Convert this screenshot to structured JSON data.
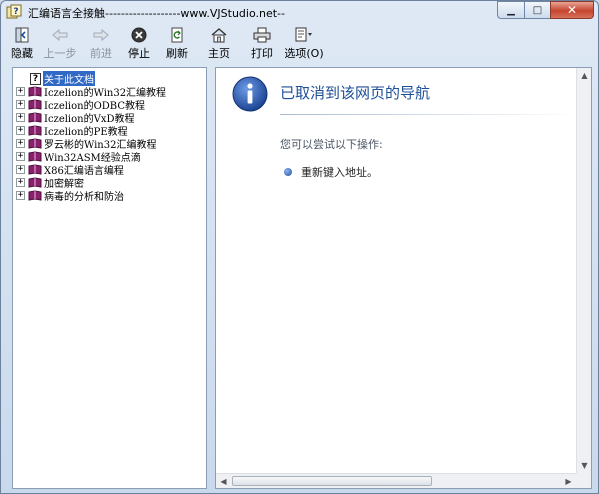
{
  "window": {
    "title": "汇编语言全接触-------------------www.VJStudio.net--"
  },
  "toolbar": {
    "buttons": [
      {
        "label": "隐藏",
        "icon": "hide-icon",
        "enabled": true
      },
      {
        "label": "上一步",
        "icon": "back-arrow-icon",
        "enabled": false
      },
      {
        "label": "前进",
        "icon": "forward-arrow-icon",
        "enabled": false
      },
      {
        "label": "停止",
        "icon": "stop-icon",
        "enabled": true
      },
      {
        "label": "刷新",
        "icon": "refresh-icon",
        "enabled": true
      },
      {
        "label": "主页",
        "icon": "home-icon",
        "enabled": true
      },
      {
        "label": "打印",
        "icon": "print-icon",
        "enabled": true
      },
      {
        "label": "选项(O)",
        "icon": "options-icon",
        "enabled": true
      }
    ]
  },
  "tree": {
    "items": [
      {
        "label": "关于此文档",
        "type": "page",
        "selected": true
      },
      {
        "label": "Iczelion的Win32汇编教程",
        "type": "book"
      },
      {
        "label": "Iczelion的ODBC教程",
        "type": "book"
      },
      {
        "label": "Iczelion的VxD教程",
        "type": "book"
      },
      {
        "label": "Iczelion的PE教程",
        "type": "book"
      },
      {
        "label": "罗云彬的Win32汇编教程",
        "type": "book"
      },
      {
        "label": "Win32ASM经验点滴",
        "type": "book"
      },
      {
        "label": "X86汇编语言编程",
        "type": "book"
      },
      {
        "label": "加密解密",
        "type": "book"
      },
      {
        "label": "病毒的分析和防治",
        "type": "book"
      }
    ]
  },
  "content": {
    "title": "已取消到该网页的导航",
    "try_text": "您可以尝试以下操作:",
    "suggestions": [
      "重新键入地址。"
    ]
  },
  "colors": {
    "title_blue": "#1d4f97",
    "selection": "#3169c6",
    "book_purple": "#8a1f6e"
  }
}
